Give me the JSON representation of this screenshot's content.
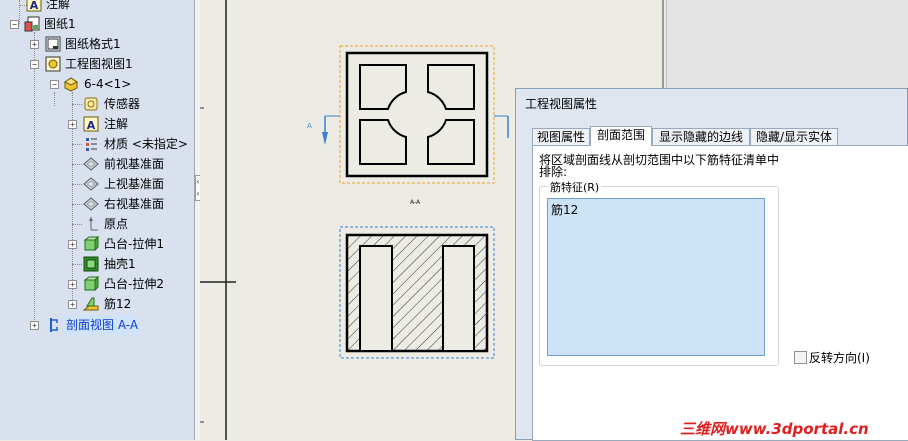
{
  "tree": {
    "items": [
      {
        "label": "注解",
        "icon": "annotation-icon"
      },
      {
        "label": "图纸1",
        "icon": "sheet-icon"
      },
      {
        "label": "图纸格式1",
        "icon": "sheet-format-icon"
      },
      {
        "label": "工程图视图1",
        "icon": "drawing-view-icon"
      },
      {
        "label": "6-4<1>",
        "icon": "part-icon"
      },
      {
        "label": "传感器",
        "icon": "sensor-icon"
      },
      {
        "label": "注解",
        "icon": "annotation-icon"
      },
      {
        "label": "材质 <未指定>",
        "icon": "material-icon"
      },
      {
        "label": "前视基准面",
        "icon": "plane-icon"
      },
      {
        "label": "上视基准面",
        "icon": "plane-icon"
      },
      {
        "label": "右视基准面",
        "icon": "plane-icon"
      },
      {
        "label": "原点",
        "icon": "origin-icon"
      },
      {
        "label": "凸台-拉伸1",
        "icon": "boss-extrude-icon"
      },
      {
        "label": "抽壳1",
        "icon": "shell-icon"
      },
      {
        "label": "凸台-拉伸2",
        "icon": "boss-extrude-icon"
      },
      {
        "label": "筋12",
        "icon": "rib-icon"
      },
      {
        "label": "剖面视图 A-A",
        "icon": "section-view-icon"
      }
    ]
  },
  "drawing": {
    "section_label": "A-A",
    "arrow_label": "A"
  },
  "dialog": {
    "title": "工程视图属性",
    "tabs": [
      "视图属性",
      "剖面范围",
      "显示隐藏的边线",
      "隐藏/显示实体"
    ],
    "active_tab": "剖面范围",
    "description": "将区域剖面线从剖切范围中以下筋特征清单中排除:",
    "group_label": "筋特征(R)",
    "list_items": [
      "筋12"
    ],
    "flip_label": "反转方向(I)",
    "flip_checked": false
  },
  "watermark": {
    "part1": "三维网",
    "part2": "www.3dportal.cn"
  },
  "colors": {
    "accent_orange": "#f0a030",
    "accent_blue": "#3a7fd5",
    "watermark_red": "#e02020"
  }
}
